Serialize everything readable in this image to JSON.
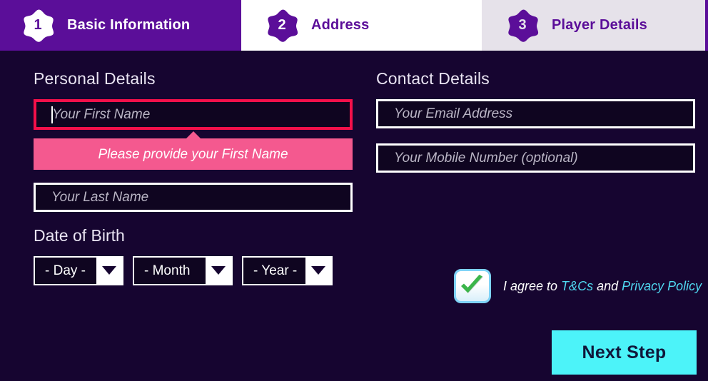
{
  "steps": [
    {
      "number": "1",
      "label": "Basic Information",
      "state": "active"
    },
    {
      "number": "2",
      "label": "Address",
      "state": "upcoming"
    },
    {
      "number": "3",
      "label": "Player Details",
      "state": "upcoming"
    }
  ],
  "personal": {
    "heading": "Personal Details",
    "first_name": {
      "value": "",
      "placeholder": "Your First Name"
    },
    "error_message": "Please provide your First Name",
    "last_name": {
      "value": "",
      "placeholder": "Your Last Name"
    }
  },
  "dob": {
    "heading": "Date of Birth",
    "day": "- Day -",
    "month": "- Month",
    "year": "- Year -"
  },
  "contact": {
    "heading": "Contact Details",
    "email": {
      "value": "",
      "placeholder": "Your Email Address"
    },
    "mobile": {
      "value": "",
      "placeholder": "Your Mobile Number (optional)"
    }
  },
  "terms": {
    "checked": true,
    "prefix": "I agree to ",
    "link_tcs": "T&Cs",
    "middle": " and ",
    "link_privacy": "Privacy Policy"
  },
  "actions": {
    "next_label": "Next Step"
  },
  "colors": {
    "page_background": "#160530",
    "step_active": "#5b0e99",
    "step_upcoming_bg": "#ffffff",
    "step_last_bg": "#e6e2ea",
    "field_fill": "#0f0520",
    "field_border": "#ffffff",
    "error_border": "#f4104a",
    "error_tooltip": "#f4598f",
    "link": "#4fd8f0",
    "next_button": "#4cf3f9",
    "next_button_text": "#10173a",
    "check_green": "#3bb54a"
  }
}
